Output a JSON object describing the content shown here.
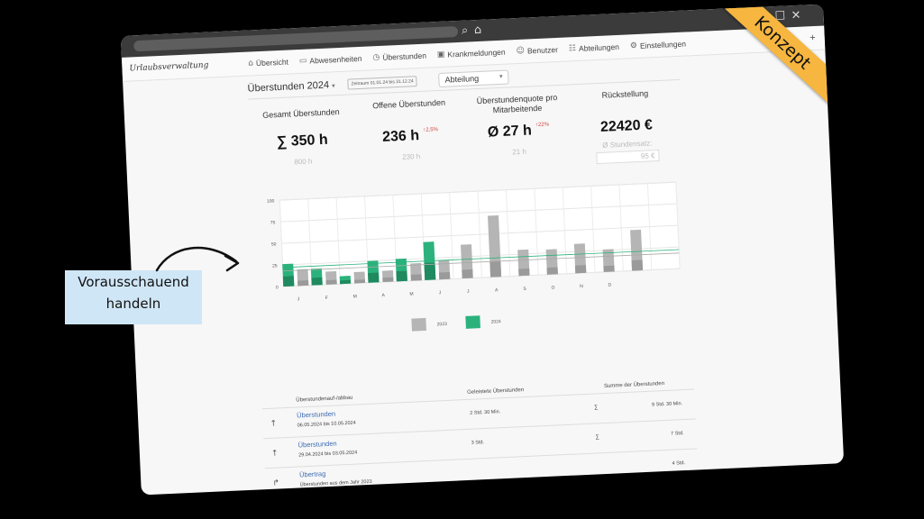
{
  "logo_text": "Urlaubsverwaltung",
  "nav": {
    "items": [
      {
        "label": "Übersicht",
        "icon": "house-icon"
      },
      {
        "label": "Abwesenheiten",
        "icon": "calendar-icon"
      },
      {
        "label": "Überstunden",
        "icon": "clock-icon"
      },
      {
        "label": "Krankmeldungen",
        "icon": "medical-bag-icon"
      },
      {
        "label": "Benutzer",
        "icon": "user-icon"
      },
      {
        "label": "Abteilungen",
        "icon": "group-icon"
      },
      {
        "label": "Einstellungen",
        "icon": "gear-icon"
      }
    ]
  },
  "header": {
    "year_select": "Überstunden 2024",
    "date_range": "Zeitraum 01.01.24 bis 31.12.24",
    "department_select": "Abteilung"
  },
  "kpis": [
    {
      "label": "Gesamt Überstunden",
      "value": "∑ 350 h",
      "trend": "",
      "sub": "800 h",
      "rate": ""
    },
    {
      "label": "Offene Überstunden",
      "value": "236 h",
      "trend": "↑2,5%",
      "sub": "230 h",
      "rate": ""
    },
    {
      "label": "Überstundenquote pro Mitarbeitende",
      "value": "Ø 27 h",
      "trend": "↑22%",
      "sub": "21 h",
      "rate": ""
    },
    {
      "label": "Rückstellung",
      "value": "22420 €",
      "trend": "",
      "sub": "Ø Stundensatz:",
      "rate": "95 €"
    }
  ],
  "chart_data": {
    "type": "bar",
    "categories": [
      "J",
      "F",
      "M",
      "A",
      "M",
      "J",
      "J",
      "A",
      "S",
      "O",
      "N",
      "D"
    ],
    "ylim": [
      0,
      100
    ],
    "yticks": [
      "100",
      "75",
      "50",
      "25",
      "0"
    ],
    "grid": true,
    "legend_position": "bottom",
    "series": [
      {
        "name": "2023",
        "color": "#b5b5b5",
        "values": [
          19,
          15,
          13,
          13,
          20,
          22,
          39,
          71,
          30,
          29,
          34,
          26,
          47
        ]
      },
      {
        "name": "2024",
        "color": "#2bb27c",
        "values": [
          26,
          19,
          9,
          25,
          26,
          44
        ]
      }
    ],
    "baseline_values": [
      6,
      5,
      4,
      5,
      7,
      8,
      10,
      18,
      8,
      8,
      9,
      7,
      12
    ]
  },
  "table": {
    "headers": [
      "Überstundenauf-/abbau",
      "Geleistete Überstunden",
      "Summe der Überstunden"
    ],
    "rows": [
      {
        "icon": "arrow-up-icon",
        "title": "Überstunden",
        "date": "06.05.2024 bis 10.05.2024",
        "hours": "2 Std. 30 Min.",
        "sigma": "∑",
        "sum": "9 Std. 30 Min."
      },
      {
        "icon": "arrow-up-icon",
        "title": "Überstunden",
        "date": "29.04.2024 bis 03.05.2024",
        "hours": "3 Std.",
        "sigma": "∑",
        "sum": "7 Std."
      },
      {
        "icon": "arrow-forward-icon",
        "title": "Übertrag",
        "date": "Überstunden aus dem Jahr 2023",
        "hours": "",
        "sigma": "",
        "sum": "4 Std."
      }
    ]
  },
  "badge": "Konzept",
  "callout": {
    "line1": "Vorausschauend",
    "line2": "handeln"
  }
}
